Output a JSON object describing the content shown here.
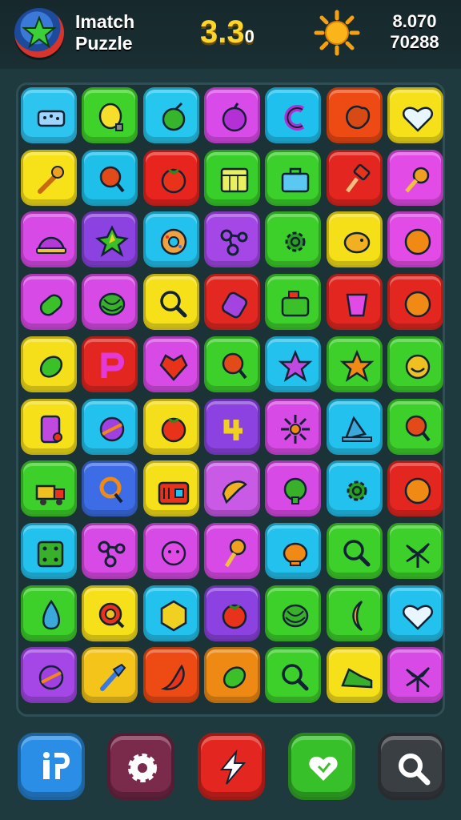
{
  "header": {
    "title_line1": "Imatch",
    "title_line2": "Puzzle",
    "score": "3.3",
    "score_suffix": "0",
    "stat_top": "8.070",
    "stat_bottom": "70288"
  },
  "board": {
    "rows": [
      [
        {
          "color": "#2ec4f0",
          "icon": "sponge-icon"
        },
        {
          "color": "#3fd22a",
          "icon": "lemon-icon"
        },
        {
          "color": "#26c7ee",
          "icon": "apple-icon"
        },
        {
          "color": "#d94be8",
          "icon": "plum-icon"
        },
        {
          "color": "#1fc0ee",
          "icon": "letter-c-icon"
        },
        {
          "color": "#ee4a14",
          "icon": "orange-blob-icon"
        },
        {
          "color": "#f5e01a",
          "icon": "heart-icon"
        }
      ],
      [
        {
          "color": "#f7e21a",
          "icon": "wrench-icon"
        },
        {
          "color": "#1ec0ea",
          "icon": "paddle-icon"
        },
        {
          "color": "#e8241f",
          "icon": "tomato-icon"
        },
        {
          "color": "#39cf2a",
          "icon": "calendar-icon"
        },
        {
          "color": "#3bd02c",
          "icon": "briefcase-icon"
        },
        {
          "color": "#e3261f",
          "icon": "hammer-icon"
        },
        {
          "color": "#e24be6",
          "icon": "candy-icon"
        }
      ],
      [
        {
          "color": "#d84ae6",
          "icon": "hat-icon"
        },
        {
          "color": "#8b42e0",
          "icon": "leaf-icon"
        },
        {
          "color": "#23c2ee",
          "icon": "donut-icon"
        },
        {
          "color": "#a447e6",
          "icon": "molecule-icon"
        },
        {
          "color": "#3dcf2a",
          "icon": "gear-icon"
        },
        {
          "color": "#f4df18",
          "icon": "pig-icon"
        },
        {
          "color": "#e24be6",
          "icon": "orange-icon"
        }
      ],
      [
        {
          "color": "#d84ae6",
          "icon": "bottle-icon"
        },
        {
          "color": "#d84ae6",
          "icon": "melon-icon"
        },
        {
          "color": "#f6e01a",
          "icon": "magnifier-icon"
        },
        {
          "color": "#e32822",
          "icon": "jar-icon"
        },
        {
          "color": "#3dcf2a",
          "icon": "toaster-icon"
        },
        {
          "color": "#e3261f",
          "icon": "cup-icon"
        },
        {
          "color": "#e3261f",
          "icon": "orange-icon"
        }
      ],
      [
        {
          "color": "#f5df1a",
          "icon": "lime-icon"
        },
        {
          "color": "#e3261f",
          "icon": "letter-p-icon"
        },
        {
          "color": "#d84ae6",
          "icon": "heart-gem-icon"
        },
        {
          "color": "#3dcf2a",
          "icon": "paddle-icon"
        },
        {
          "color": "#23c2ee",
          "icon": "star-blob-icon"
        },
        {
          "color": "#3dcf2a",
          "icon": "star-icon"
        },
        {
          "color": "#3dcf2a",
          "icon": "smile-icon"
        }
      ],
      [
        {
          "color": "#f6e01a",
          "icon": "phone-icon"
        },
        {
          "color": "#23c2ee",
          "icon": "ball-icon"
        },
        {
          "color": "#f5df1a",
          "icon": "tomato-icon"
        },
        {
          "color": "#8b42e0",
          "icon": "symbol-icon"
        },
        {
          "color": "#d84ae6",
          "icon": "flower-icon"
        },
        {
          "color": "#23c2ee",
          "icon": "bell-icon"
        },
        {
          "color": "#3dcf2a",
          "icon": "paddle-icon"
        }
      ],
      [
        {
          "color": "#3dcf2a",
          "icon": "truck-icon"
        },
        {
          "color": "#3d6de6",
          "icon": "ring-icon"
        },
        {
          "color": "#f6e01a",
          "icon": "radio-icon"
        },
        {
          "color": "#c85ae6",
          "icon": "bird-icon"
        },
        {
          "color": "#d84ae6",
          "icon": "bush-icon"
        },
        {
          "color": "#23c2ee",
          "icon": "gear-icon"
        },
        {
          "color": "#e3261f",
          "icon": "orange-icon"
        }
      ],
      [
        {
          "color": "#23c2ee",
          "icon": "dice-icon"
        },
        {
          "color": "#d84ae6",
          "icon": "molecule-icon"
        },
        {
          "color": "#d84ae6",
          "icon": "face-icon"
        },
        {
          "color": "#d84ae6",
          "icon": "lollipop-icon"
        },
        {
          "color": "#23c2ee",
          "icon": "pot-icon"
        },
        {
          "color": "#3dcf2a",
          "icon": "magnifier-icon"
        },
        {
          "color": "#3dcf2a",
          "icon": "palm-icon"
        }
      ],
      [
        {
          "color": "#3dcf2a",
          "icon": "drop-icon"
        },
        {
          "color": "#f6e01a",
          "icon": "target-icon"
        },
        {
          "color": "#23c2ee",
          "icon": "hexagon-icon"
        },
        {
          "color": "#8b42e0",
          "icon": "tomato-icon"
        },
        {
          "color": "#3dcf2a",
          "icon": "melon-icon"
        },
        {
          "color": "#3dcf2a",
          "icon": "banana-icon"
        },
        {
          "color": "#23c2ee",
          "icon": "heart-icon"
        }
      ],
      [
        {
          "color": "#a447e6",
          "icon": "ball-icon"
        },
        {
          "color": "#f5c41a",
          "icon": "brush-icon"
        },
        {
          "color": "#ee4a14",
          "icon": "pepper-icon"
        },
        {
          "color": "#ee8a14",
          "icon": "lime-icon"
        },
        {
          "color": "#3dcf2a",
          "icon": "magnifier-icon"
        },
        {
          "color": "#f6e01a",
          "icon": "shoe-icon"
        },
        {
          "color": "#d84ae6",
          "icon": "palm-icon"
        }
      ]
    ]
  },
  "toolbar": {
    "buttons": [
      {
        "name": "info-button",
        "icon": "info-icon",
        "color": "#2a8ee6"
      },
      {
        "name": "settings-button",
        "icon": "gear-icon",
        "color": "#7a2a4a"
      },
      {
        "name": "boost-button",
        "icon": "lightning-icon",
        "color": "#e3261f"
      },
      {
        "name": "favorite-button",
        "icon": "heart-icon",
        "color": "#37c02a"
      },
      {
        "name": "search-button",
        "icon": "search-icon",
        "color": "#3a3f44"
      }
    ]
  }
}
